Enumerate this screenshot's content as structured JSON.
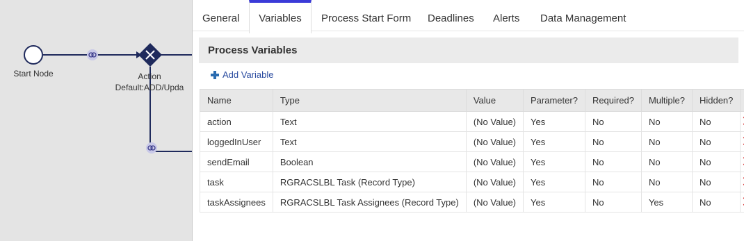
{
  "canvas": {
    "start_node_label": "Start Node",
    "action_label_line1": "Action",
    "action_label_line2": "Default:ADD/Upda"
  },
  "tabs": [
    {
      "label": "General"
    },
    {
      "label": "Variables",
      "active": true
    },
    {
      "label": "Process Start Form"
    },
    {
      "label": "Deadlines"
    },
    {
      "label": "Alerts"
    },
    {
      "label": "Data Management"
    }
  ],
  "section": {
    "title": "Process Variables",
    "add_variable_label": "Add Variable"
  },
  "table": {
    "headers": [
      "Name",
      "Type",
      "Value",
      "Parameter?",
      "Required?",
      "Multiple?",
      "Hidden?",
      ""
    ],
    "rows": [
      {
        "name": "action",
        "type": "Text",
        "value": "(No Value)",
        "parameter": "Yes",
        "required": "No",
        "multiple": "No",
        "hidden": "No"
      },
      {
        "name": "loggedInUser",
        "type": "Text",
        "value": "(No Value)",
        "parameter": "Yes",
        "required": "No",
        "multiple": "No",
        "hidden": "No"
      },
      {
        "name": "sendEmail",
        "type": "Boolean",
        "value": "(No Value)",
        "parameter": "Yes",
        "required": "No",
        "multiple": "No",
        "hidden": "No"
      },
      {
        "name": "task",
        "type": "RGRACSLBL Task (Record Type)",
        "value": "(No Value)",
        "parameter": "Yes",
        "required": "No",
        "multiple": "No",
        "hidden": "No"
      },
      {
        "name": "taskAssignees",
        "type": "RGRACSLBL Task Assignees (Record Type)",
        "value": "(No Value)",
        "parameter": "Yes",
        "required": "No",
        "multiple": "Yes",
        "hidden": "No"
      }
    ]
  },
  "colors": {
    "accent": "#3a3ad8",
    "node": "#1f2a5c",
    "delete": "#d42020",
    "link": "#2b4ca0"
  },
  "icons": {
    "start": "circle-start-node-icon",
    "gateway": "gateway-x-icon",
    "connector": "link-chain-icon",
    "add": "plus-icon",
    "delete": "delete-x-icon"
  }
}
